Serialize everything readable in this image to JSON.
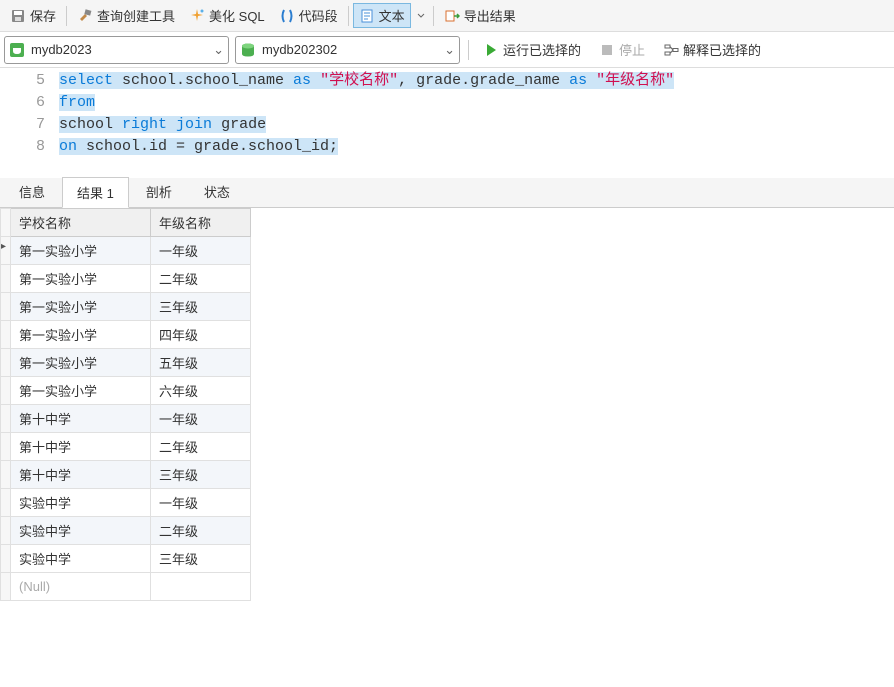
{
  "toolbar": {
    "save": "保存",
    "query_builder": "查询创建工具",
    "beautify": "美化 SQL",
    "snippet": "代码段",
    "text": "文本",
    "export": "导出结果"
  },
  "dbbar": {
    "conn": "mydb2023",
    "db": "mydb202302",
    "run": "运行已选择的",
    "stop": "停止",
    "explain": "解释已选择的"
  },
  "editor": {
    "lines": [
      5,
      6,
      7,
      8
    ],
    "l5": {
      "kw_select": "select",
      "ident1": " school.school_name ",
      "kw_as1": "as",
      "sp1": " ",
      "str1": "\"学校名称\"",
      "comma": ", grade.grade_name ",
      "kw_as2": "as",
      "sp2": " ",
      "str2": "\"年级名称\""
    },
    "l6": {
      "kw_from": "from"
    },
    "l7": {
      "ident1": "school ",
      "kw_right": "right",
      "sp1": " ",
      "kw_join": "join",
      "ident2": " grade"
    },
    "l8": {
      "kw_on": "on",
      "rest": " school.id = grade.school_id;"
    }
  },
  "tabs": {
    "info": "信息",
    "result": "结果 1",
    "profile": "剖析",
    "status": "状态"
  },
  "grid": {
    "headers": [
      "学校名称",
      "年级名称"
    ],
    "rows": [
      [
        "第一实验小学",
        "一年级"
      ],
      [
        "第一实验小学",
        "二年级"
      ],
      [
        "第一实验小学",
        "三年级"
      ],
      [
        "第一实验小学",
        "四年级"
      ],
      [
        "第一实验小学",
        "五年级"
      ],
      [
        "第一实验小学",
        "六年级"
      ],
      [
        "第十中学",
        "一年级"
      ],
      [
        "第十中学",
        "二年级"
      ],
      [
        "第十中学",
        "三年级"
      ],
      [
        "实验中学",
        "一年级"
      ],
      [
        "实验中学",
        "二年级"
      ],
      [
        "实验中学",
        "三年级"
      ]
    ],
    "null_label": "(Null)"
  }
}
